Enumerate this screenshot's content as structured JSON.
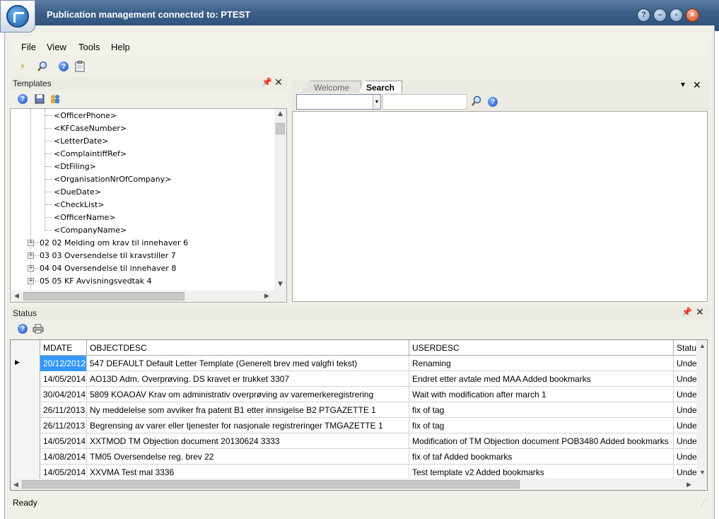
{
  "window": {
    "title": "Publication management connected to: PTEST"
  },
  "menu": [
    "File",
    "View",
    "Tools",
    "Help"
  ],
  "templates_panel": {
    "title": "Templates",
    "fields": [
      "<OfficerPhone>",
      "<KFCaseNumber>",
      "<LetterDate>",
      "<ComplaintiffRef>",
      "<DtFiling>",
      "<OrganisationNrOfCompany>",
      "<DueDate>",
      "<CheckList>",
      "<OfficerName>",
      "<CompanyName>"
    ],
    "groups": [
      "02 02 Melding om krav til innehaver 6",
      "03 03 Oversendelse til kravstiller 7",
      "04 04 Oversendelse til innehaver 8",
      "05 05 KF Avvisningsvedtak 4"
    ]
  },
  "search_panel": {
    "tabs": [
      "Welcome",
      "Search"
    ],
    "active_tab": "Search"
  },
  "status_panel": {
    "title": "Status",
    "columns": [
      "MDATE",
      "OBJECTDESC",
      "USERDESC",
      "Status"
    ],
    "rows": [
      {
        "mdate": "20/12/2012",
        "objectdesc": "547 DEFAULT Default Letter Template (Generelt brev med valgfri tekst)",
        "userdesc": "Renaming",
        "status": "Unde"
      },
      {
        "mdate": "14/05/2014",
        "objectdesc": "AO13D Adm. Overprøving. DS kravet er trukket 3307",
        "userdesc": "Endret etter avtale med MAA Added bookmarks",
        "status": "Unde"
      },
      {
        "mdate": "30/04/2014",
        "objectdesc": "5809 KOAOAV Krav om administrativ overprøving av varemerkeregistrering",
        "userdesc": "Wait with modification after march 1",
        "status": "Unde"
      },
      {
        "mdate": "26/11/2013",
        "objectdesc": "Ny meddelelse som avviker fra patent B1 etter innsigelse B2 PTGAZETTE 1",
        "userdesc": "fix of tag",
        "status": "Unde"
      },
      {
        "mdate": "26/11/2013",
        "objectdesc": "Begrensing av varer eller tjenester for nasjonale registreringer TMGAZETTE 1",
        "userdesc": "fix of tag",
        "status": "Unde"
      },
      {
        "mdate": "14/05/2014",
        "objectdesc": "XXTMOD TM Objection document 20130624 3333",
        "userdesc": "Modification of TM Objection document POB3480 Added bookmarks",
        "status": "Unde"
      },
      {
        "mdate": "14/08/2014",
        "objectdesc": "TM05 Oversendelse reg. brev 22",
        "userdesc": "fix of taf Added bookmarks",
        "status": "Unde"
      },
      {
        "mdate": "14/05/2014",
        "objectdesc": "XXVMA Test mal 3336",
        "userdesc": "Test template v2 Added bookmarks",
        "status": "Unde"
      }
    ]
  },
  "statusbar": {
    "text": "Ready"
  },
  "colors": {
    "titlebar": "#3d6088",
    "selection": "#3399ff",
    "frame": "#f1f0e8"
  }
}
